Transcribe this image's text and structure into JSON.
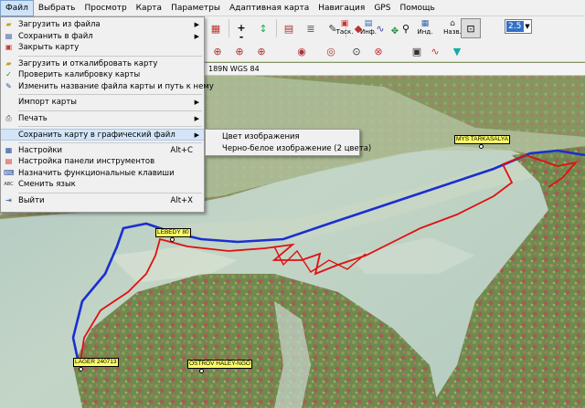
{
  "menubar": {
    "items": [
      "Файл",
      "Выбрать",
      "Просмотр",
      "Карта",
      "Параметры",
      "Адаптивная карта",
      "Навигация",
      "GPS",
      "Помощь"
    ]
  },
  "toolbar": {
    "zoom_value": "2.5",
    "labels": {
      "plus": "+",
      "minus": "-",
      "task": "Таск.",
      "info": "Инф.",
      "ind": "Инд.",
      "back": "Назв."
    }
  },
  "statusline": {
    "text": "189N   WGS 84"
  },
  "file_menu": {
    "items": [
      {
        "label": "Загрузить из файла",
        "icon": "folder-icon",
        "submenu": true
      },
      {
        "label": "Сохранить в файл",
        "icon": "save-icon",
        "submenu": true
      },
      {
        "label": "Закрыть карту",
        "icon": "close-map-icon"
      },
      {
        "label": "Загрузить и откалибровать карту",
        "icon": "calibrate-icon"
      },
      {
        "label": "Проверить калибровку карты",
        "icon": "check-calibration-icon"
      },
      {
        "label": "Изменить название файла карты и путь к нему",
        "icon": "rename-icon"
      },
      {
        "label": "Импорт карты",
        "submenu": true
      },
      {
        "label": "Печать",
        "icon": "print-icon",
        "submenu": true
      },
      {
        "label": "Сохранить карту в графический файл",
        "submenu": true
      },
      {
        "label": "Настройки",
        "icon": "settings-icon",
        "shortcut": "Alt+C"
      },
      {
        "label": "Настройка панели инструментов",
        "icon": "toolbar-settings-icon"
      },
      {
        "label": "Назначить функциональные клавиши",
        "icon": "keyboard-icon"
      },
      {
        "label": "Сменить язык",
        "icon": "language-icon",
        "icon_text": "ABC"
      },
      {
        "label": "Выйти",
        "icon": "exit-icon",
        "shortcut": "Alt+X"
      }
    ]
  },
  "sub_menu": {
    "items": [
      "Цвет изображения",
      "Черно-белое изображение (2 цвета)"
    ]
  },
  "map_labels": [
    "MYS TARKASALYA",
    "LEBEDY 80",
    "LAGER 240713",
    "OSTROV HALEY-NGO"
  ],
  "colors": {
    "track_blue": "#1a2fd0",
    "track_red": "#e01010",
    "label_bg": "#ffff66",
    "menu_highlight": "#d3e5f7",
    "water": "#b9cfc4",
    "land": "#6f8a4e"
  }
}
